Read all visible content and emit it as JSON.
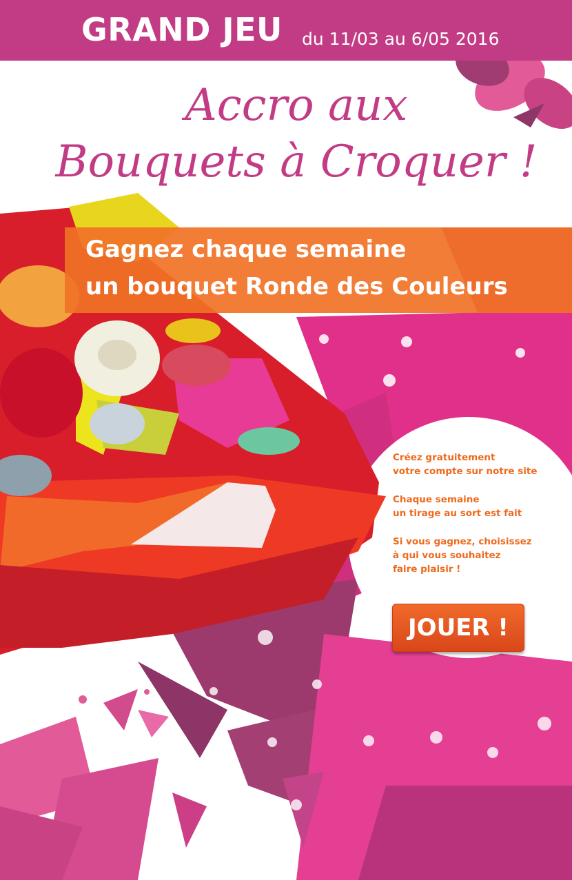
{
  "header": {
    "title": "GRAND JEU",
    "dates": "du 11/03 au 6/05 2016"
  },
  "headline": {
    "line1": "Accro aux",
    "line2": "Bouquets à Croquer !"
  },
  "banner": {
    "line1": "Gagnez chaque semaine",
    "line2": "un bouquet Ronde des Couleurs"
  },
  "steps": [
    {
      "text": "Créez gratuitement\nvotre compte sur notre site"
    },
    {
      "text": "Chaque semaine\nun tirage au sort est fait"
    },
    {
      "text": "Si vous gagnez, choisissez\nà qui vous souhaitez\nfaire plaisir !"
    }
  ],
  "cta": {
    "label": "JOUER !"
  },
  "colors": {
    "brand_pink": "#c23b85",
    "orange": "#f07226",
    "magenta_petal": "#e0308a",
    "purple_petal": "#9c3a6e"
  },
  "images": {
    "bouquet": "candy-bouquet-photo",
    "flower": "stylized-pink-flower"
  }
}
